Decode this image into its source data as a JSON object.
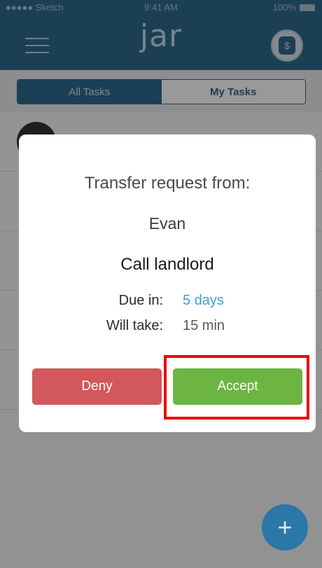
{
  "status_bar": {
    "carrier": "●●●●● Sketch",
    "time": "9:41 AM",
    "battery": "100%"
  },
  "header": {
    "logo": "jar",
    "jar_button_symbol": "$"
  },
  "tabs": [
    {
      "label": "All Tasks",
      "active": true
    },
    {
      "label": "My Tasks",
      "active": false
    }
  ],
  "modal": {
    "title": "Transfer request from:",
    "sender": "Evan",
    "task_name": "Call landlord",
    "due_label": "Due in:",
    "due_value": "5 days",
    "take_label": "Will take:",
    "take_value": "15 min",
    "deny_label": "Deny",
    "accept_label": "Accept"
  },
  "fab": {
    "symbol": "+"
  },
  "colors": {
    "header": "#2e6b8f",
    "deny": "#d3585c",
    "accept": "#6db543",
    "due_value": "#3aa0d8",
    "highlight": "#ee0000"
  }
}
